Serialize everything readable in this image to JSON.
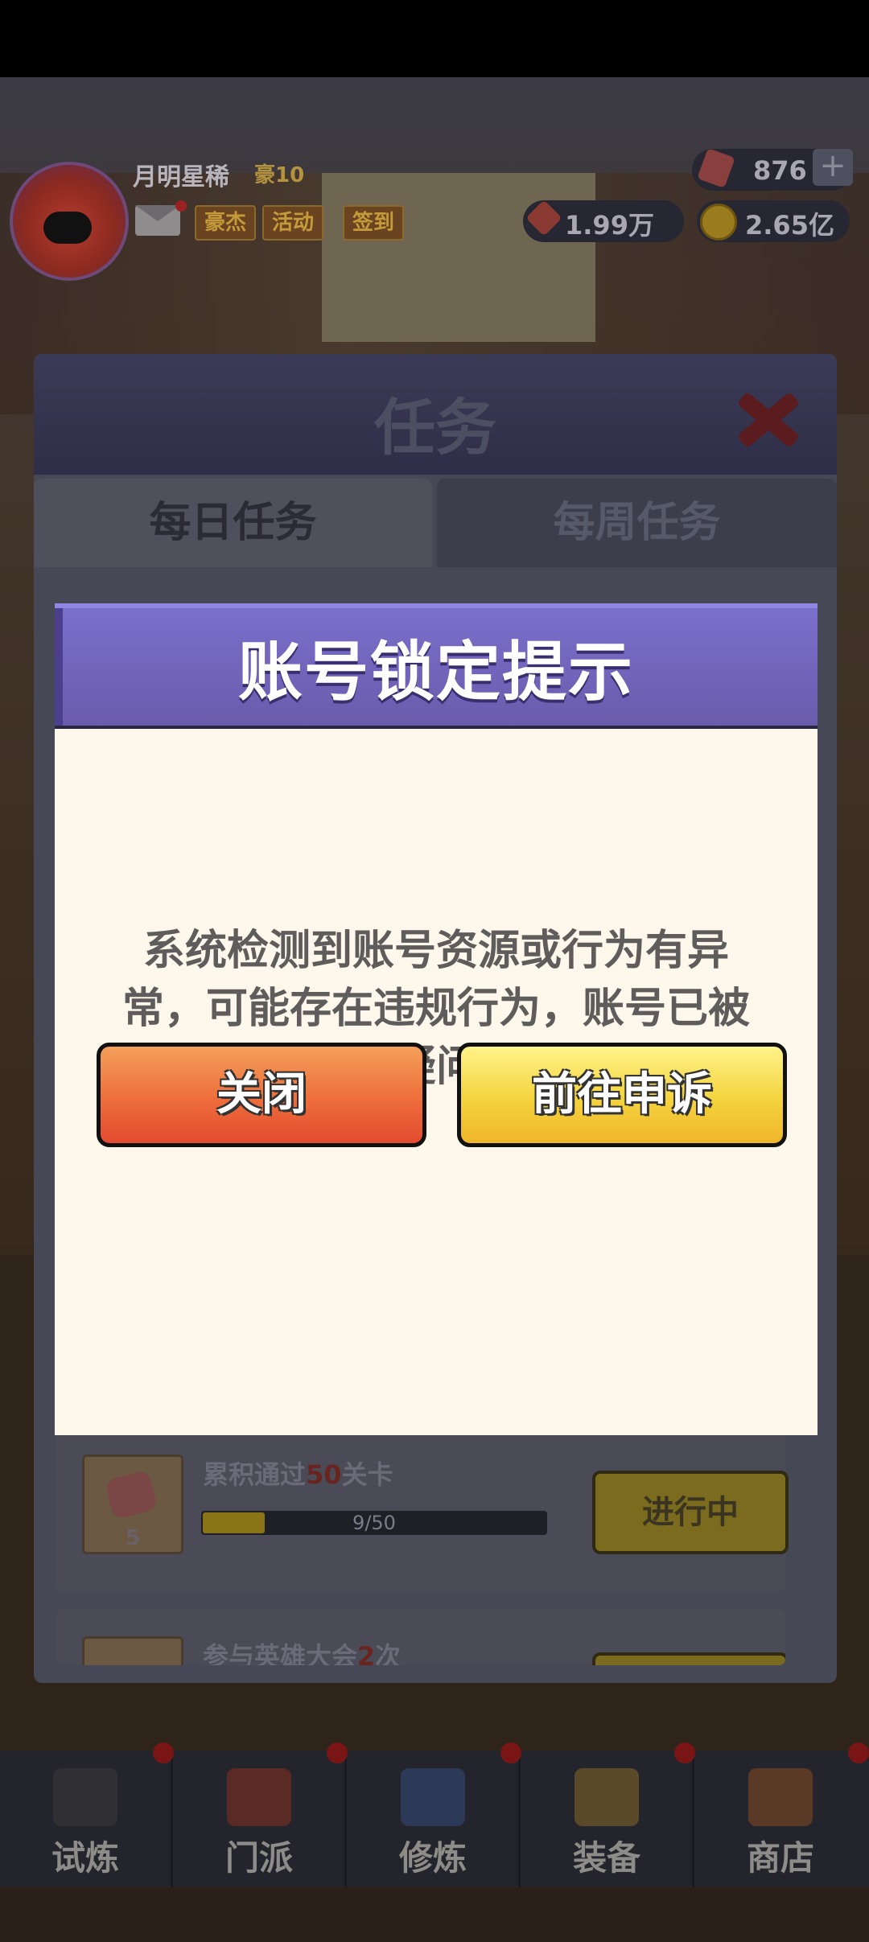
{
  "player": {
    "name": "月明星稀",
    "vip": "豪10",
    "gems": "876",
    "tokens": "1.99万",
    "gold": "2.65亿"
  },
  "hud_buttons": {
    "hero": "豪杰",
    "activity": "活动",
    "signin": "签到"
  },
  "task_window": {
    "title": "任务",
    "tabs": [
      "每日任务",
      "每周任务"
    ],
    "items": [
      {
        "name_prefix": "累积通过",
        "name_highlight": "50",
        "name_suffix": "关卡",
        "reward_count": "5",
        "progress_text": "9/50",
        "progress": 0.18,
        "status": "进行中"
      },
      {
        "name_prefix": "参与英雄大会",
        "name_highlight": "2",
        "name_suffix": "次"
      }
    ]
  },
  "bottom_nav": [
    "试炼",
    "门派",
    "修炼",
    "装备",
    "商店"
  ],
  "modal": {
    "title": "账号锁定提示",
    "message": "系统检测到账号资源或行为有异常，可能存在违规行为，账号已被锁定。如有疑问请前往申诉",
    "close_button": "关闭",
    "appeal_button": "前往申诉"
  },
  "colors": {
    "modal_header": "#6a5bab",
    "modal_body": "#fdf8eb",
    "close_button": "#ee6d3b",
    "appeal_button": "#f4d33d"
  }
}
